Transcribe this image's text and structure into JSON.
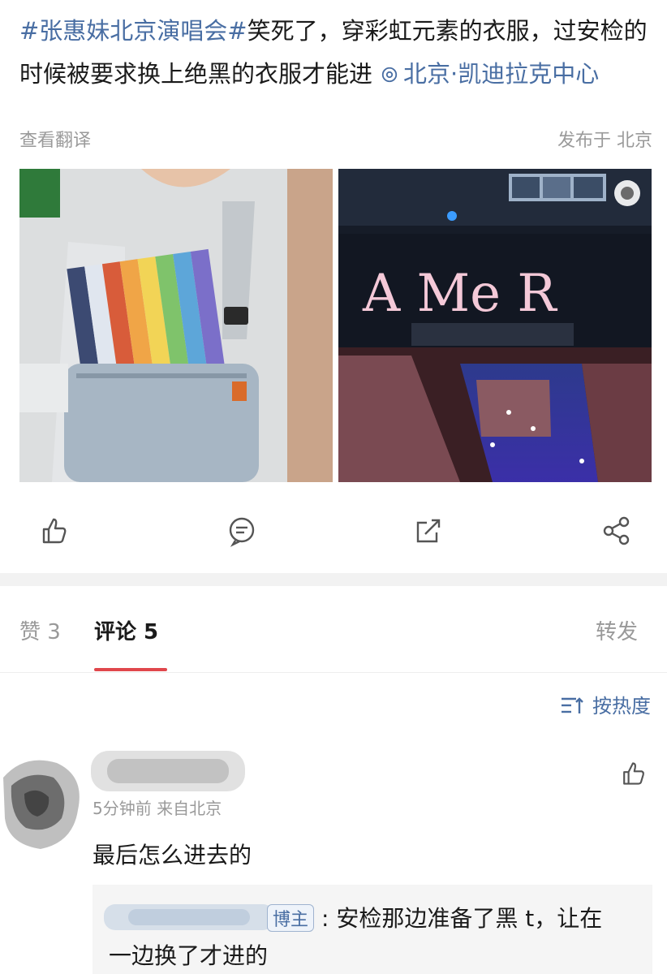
{
  "post": {
    "hashtag": "#张惠妹北京演唱会#",
    "text": "笑死了，穿彩虹元素的衣服，过安检的时候被要求换上绝黑的衣服才能进",
    "location": "北京·凯迪拉克中心",
    "translate_label": "查看翻译",
    "published_label": "发布于 北京",
    "stage_text": "A Me R",
    "icons": [
      "location-pin-icon",
      "like-icon",
      "comment-icon",
      "repost-icon",
      "share-icon"
    ]
  },
  "tabs": {
    "likes_label": "赞 3",
    "comments_label": "评论 5",
    "repost_label": "转发",
    "active_color": "#e0474c"
  },
  "sort": {
    "label": "按热度",
    "icon": "sort-icon"
  },
  "comment": {
    "meta": "5分钟前 来自北京",
    "text": "最后怎么进去的",
    "reply": {
      "badge": "博主",
      "line1": ": 安检那边准备了黑 t，让在",
      "line2": "一边换了才进的"
    }
  },
  "colors": {
    "link": "#496ea3",
    "muted": "#9a9a9a",
    "text": "#1a1a1a"
  }
}
